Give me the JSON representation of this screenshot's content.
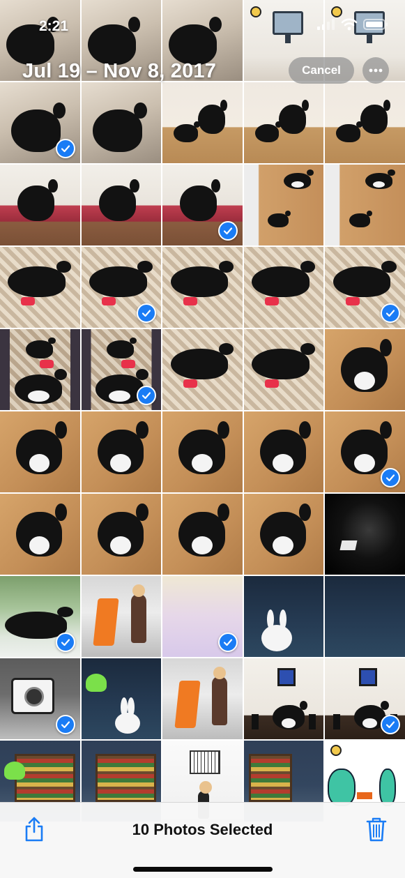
{
  "status_bar": {
    "time": "2:21"
  },
  "header": {
    "date_range": "Jul 19 – Nov 8, 2017",
    "cancel_label": "Cancel"
  },
  "toolbar": {
    "selection_text": "10 Photos Selected"
  },
  "colors": {
    "accent": "#1a7cf5",
    "toolbar_bg": "#f7f7f7"
  },
  "icons": {
    "share": "share-icon",
    "trash": "trash-icon",
    "more": "ellipsis-icon",
    "check": "checkmark-icon"
  },
  "grid": {
    "columns": 5,
    "photos": [
      {
        "scene": "bed",
        "selected": false
      },
      {
        "scene": "bed",
        "selected": false
      },
      {
        "scene": "bed",
        "selected": false
      },
      {
        "scene": "cartoon-desk",
        "selected": false
      },
      {
        "scene": "cartoon-desk",
        "selected": false
      },
      {
        "scene": "bed-cat",
        "selected": true
      },
      {
        "scene": "bed-cat",
        "selected": false
      },
      {
        "scene": "room-cats",
        "selected": false
      },
      {
        "scene": "room-cats",
        "selected": false
      },
      {
        "scene": "room-cats",
        "selected": false
      },
      {
        "scene": "cushion-cat",
        "selected": false
      },
      {
        "scene": "cushion-cat",
        "selected": false
      },
      {
        "scene": "cushion-cat",
        "selected": true
      },
      {
        "scene": "floor-cats",
        "selected": false
      },
      {
        "scene": "floor-cats",
        "selected": false
      },
      {
        "scene": "rug-cat",
        "selected": false
      },
      {
        "scene": "rug-cat",
        "selected": true
      },
      {
        "scene": "rug-cat",
        "selected": false
      },
      {
        "scene": "rug-cat",
        "selected": false
      },
      {
        "scene": "rug-cat",
        "selected": true
      },
      {
        "scene": "rug-runner",
        "selected": false
      },
      {
        "scene": "rug-runner",
        "selected": true
      },
      {
        "scene": "rug-cat",
        "selected": false
      },
      {
        "scene": "rug-cat",
        "selected": false
      },
      {
        "scene": "floor-tux",
        "selected": false
      },
      {
        "scene": "floor-tux",
        "selected": false
      },
      {
        "scene": "floor-tux",
        "selected": false
      },
      {
        "scene": "floor-tux",
        "selected": false
      },
      {
        "scene": "floor-tux",
        "selected": false
      },
      {
        "scene": "floor-tux",
        "selected": true
      },
      {
        "scene": "floor-tux",
        "selected": false
      },
      {
        "scene": "floor-tux",
        "selected": false
      },
      {
        "scene": "floor-tux",
        "selected": false
      },
      {
        "scene": "floor-tux",
        "selected": false
      },
      {
        "scene": "dark-laptop",
        "selected": false
      },
      {
        "scene": "window-cat",
        "selected": true
      },
      {
        "scene": "store-kiosk",
        "selected": false
      },
      {
        "scene": "cartoon-room",
        "selected": true
      },
      {
        "scene": "castle-bunny",
        "selected": false
      },
      {
        "scene": "castle-scene",
        "selected": false
      },
      {
        "scene": "camera",
        "selected": true
      },
      {
        "scene": "castle-ghost",
        "selected": false
      },
      {
        "scene": "store-kiosk",
        "selected": false
      },
      {
        "scene": "wall-cat",
        "selected": false
      },
      {
        "scene": "wall-cat",
        "selected": true
      },
      {
        "scene": "library-ghost",
        "selected": false
      },
      {
        "scene": "library",
        "selected": false
      },
      {
        "scene": "maze-person",
        "selected": false
      },
      {
        "scene": "library-torch",
        "selected": false
      },
      {
        "scene": "egg-arrow",
        "selected": false
      }
    ]
  }
}
